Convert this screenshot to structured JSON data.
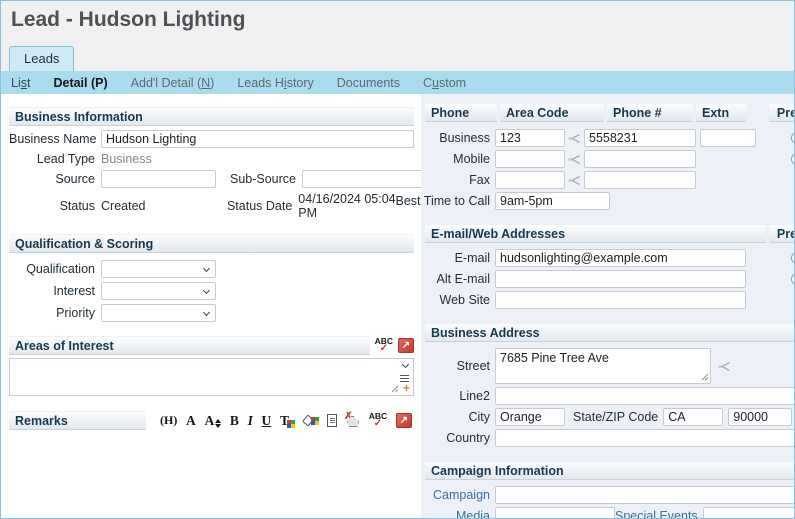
{
  "window": {
    "title": "Lead - Hudson Lighting"
  },
  "tab": "Leads",
  "subtabs": [
    {
      "pre": "Li",
      "accel": "s",
      "post": "t"
    },
    {
      "pre": "Detail (P)",
      "accel": "",
      "post": ""
    },
    {
      "pre": "Add'l Detail (",
      "accel": "N",
      "post": ")"
    },
    {
      "pre": "Leads H",
      "accel": "i",
      "post": "story"
    },
    {
      "pre": "Documents",
      "accel": "",
      "post": ""
    },
    {
      "pre": "C",
      "accel": "u",
      "post": "stom"
    }
  ],
  "business_info": {
    "title": "Business Information",
    "business_name_label": "Business Name",
    "business_name": "Hudson Lighting",
    "lead_type_label": "Lead Type",
    "lead_type": "Business",
    "source_label": "Source",
    "source": "",
    "sub_source_label": "Sub-Source",
    "sub_source": "",
    "status_label": "Status",
    "status": "Created",
    "status_date_label": "Status Date",
    "status_date": "04/16/2024 05:04 PM"
  },
  "qualification": {
    "title": "Qualification & Scoring",
    "qualification_label": "Qualification",
    "qualification": "",
    "interest_label": "Interest",
    "interest": "",
    "priority_label": "Priority",
    "priority": ""
  },
  "areas_of_interest": {
    "title": "Areas of Interest",
    "value": ""
  },
  "remarks": {
    "title": "Remarks",
    "toolbar": [
      {
        "name": "html-icon",
        "glyph": "(H)"
      },
      {
        "name": "font-icon",
        "glyph": "A"
      },
      {
        "name": "font-size-icon",
        "glyph": "A"
      },
      {
        "name": "bold-icon",
        "glyph": "B"
      },
      {
        "name": "italic-icon",
        "glyph": "I"
      },
      {
        "name": "underline-icon",
        "glyph": "U"
      },
      {
        "name": "text-color-icon",
        "glyph": "T"
      },
      {
        "name": "highlight-icon",
        "glyph": ""
      },
      {
        "name": "document-icon",
        "glyph": ""
      },
      {
        "name": "clear-format-icon",
        "glyph": ""
      },
      {
        "name": "spellcheck-icon",
        "glyph": "ABC"
      },
      {
        "name": "expand-icon",
        "glyph": ""
      }
    ]
  },
  "phone": {
    "headers": [
      "Phone",
      "Area Code",
      "Phone #",
      "Extn",
      "Pref."
    ],
    "rows": [
      {
        "label": "Business",
        "area_code": "123",
        "number": "5558231",
        "extn": ""
      },
      {
        "label": "Mobile",
        "area_code": "",
        "number": ""
      },
      {
        "label": "Fax",
        "area_code": "",
        "number": ""
      }
    ],
    "best_time_label": "Best Time to Call",
    "best_time": "9am-5pm"
  },
  "email": {
    "title": "E-mail/Web Addresses",
    "pref_label": "Pref.",
    "email_label": "E-mail",
    "email": "hudsonlighting@example.com",
    "alt_email_label": "Alt E-mail",
    "alt_email": "",
    "web_site_label": "Web Site",
    "web_site": ""
  },
  "address": {
    "title": "Business Address",
    "street_label": "Street",
    "street": "7685 Pine Tree Ave",
    "line2_label": "Line2",
    "line2": "",
    "city_label": "City",
    "city": "Orange",
    "state_zip_label": "State/ZIP Code",
    "state": "CA",
    "zip": "90000",
    "country_label": "Country",
    "country": ""
  },
  "campaign": {
    "title": "Campaign Information",
    "campaign_label": "Campaign",
    "campaign": "",
    "media_label": "Media",
    "media": "",
    "special_events_label": "Special Events",
    "special_events": ""
  },
  "icons": {
    "spellcheck_text": "ABC",
    "check": "✓",
    "expand_arrow": "↗",
    "plus": "+",
    "clear_x": "✗"
  },
  "colors": {
    "accent_red": "#c13a32",
    "tab_bar": "#a9dcee",
    "link_blue": "#3a6fa5",
    "header_text": "#16394f"
  }
}
